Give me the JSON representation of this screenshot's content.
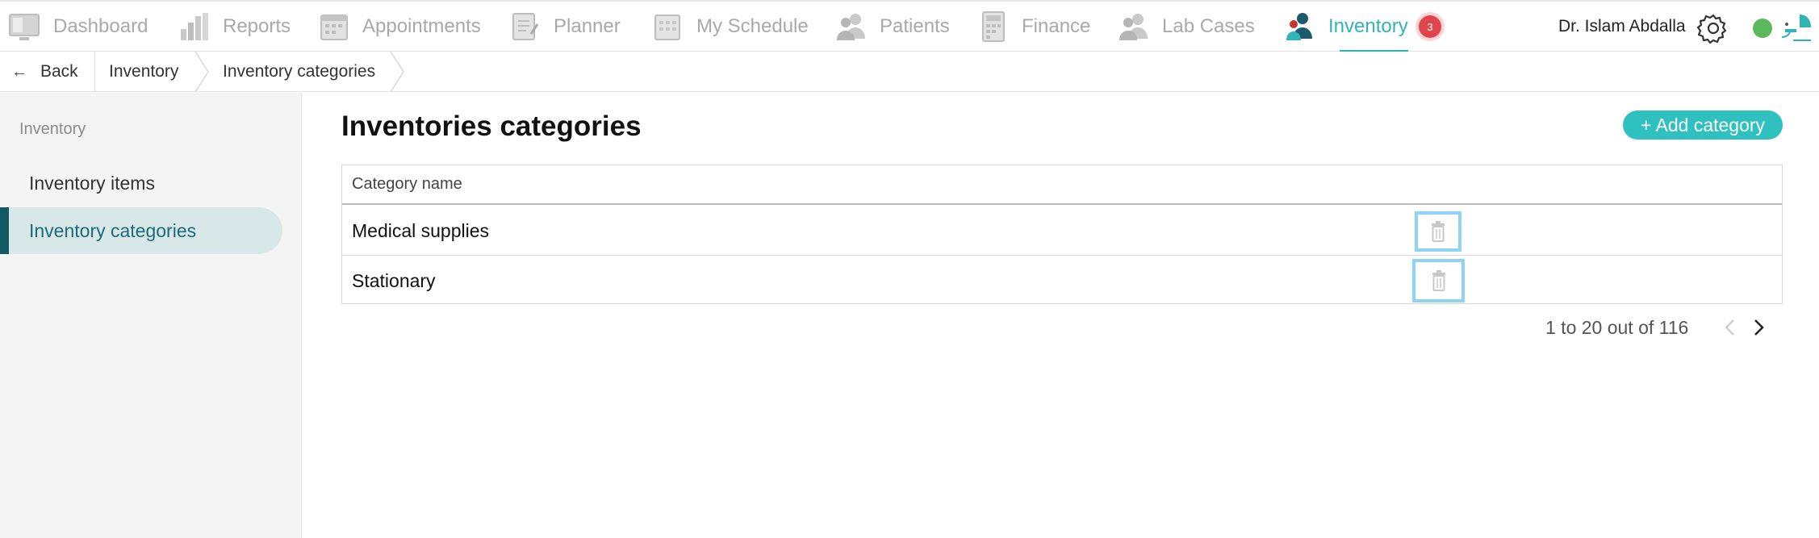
{
  "nav": {
    "items": [
      {
        "label": "Dashboard",
        "icon": "dashboard-icon"
      },
      {
        "label": "Reports",
        "icon": "reports-icon"
      },
      {
        "label": "Appointments",
        "icon": "appointments-icon"
      },
      {
        "label": "Planner",
        "icon": "planner-icon"
      },
      {
        "label": "My Schedule",
        "icon": "schedule-icon"
      },
      {
        "label": "Patients",
        "icon": "patients-icon"
      },
      {
        "label": "Finance",
        "icon": "finance-icon"
      },
      {
        "label": "Lab Cases",
        "icon": "lab-cases-icon"
      },
      {
        "label": "Inventory",
        "icon": "inventory-icon",
        "active": true
      }
    ],
    "inventory_badge": "3",
    "user_name": "Dr. Islam Abdalla",
    "status_color": "#5cb85c",
    "accent_color": "#2fb5b8"
  },
  "breadcrumb": {
    "back_label": "Back",
    "items": [
      "Inventory",
      "Inventory categories"
    ]
  },
  "sidebar": {
    "heading": "Inventory",
    "items": [
      {
        "label": "Inventory items",
        "active": false
      },
      {
        "label": "Inventory categories",
        "active": true
      }
    ]
  },
  "main": {
    "title": "Inventories categories",
    "add_button": "+ Add category",
    "table": {
      "header": "Category name",
      "rows": [
        "Medical supplies",
        "Stationary"
      ]
    },
    "pagination": "1 to 20 out of 116"
  }
}
